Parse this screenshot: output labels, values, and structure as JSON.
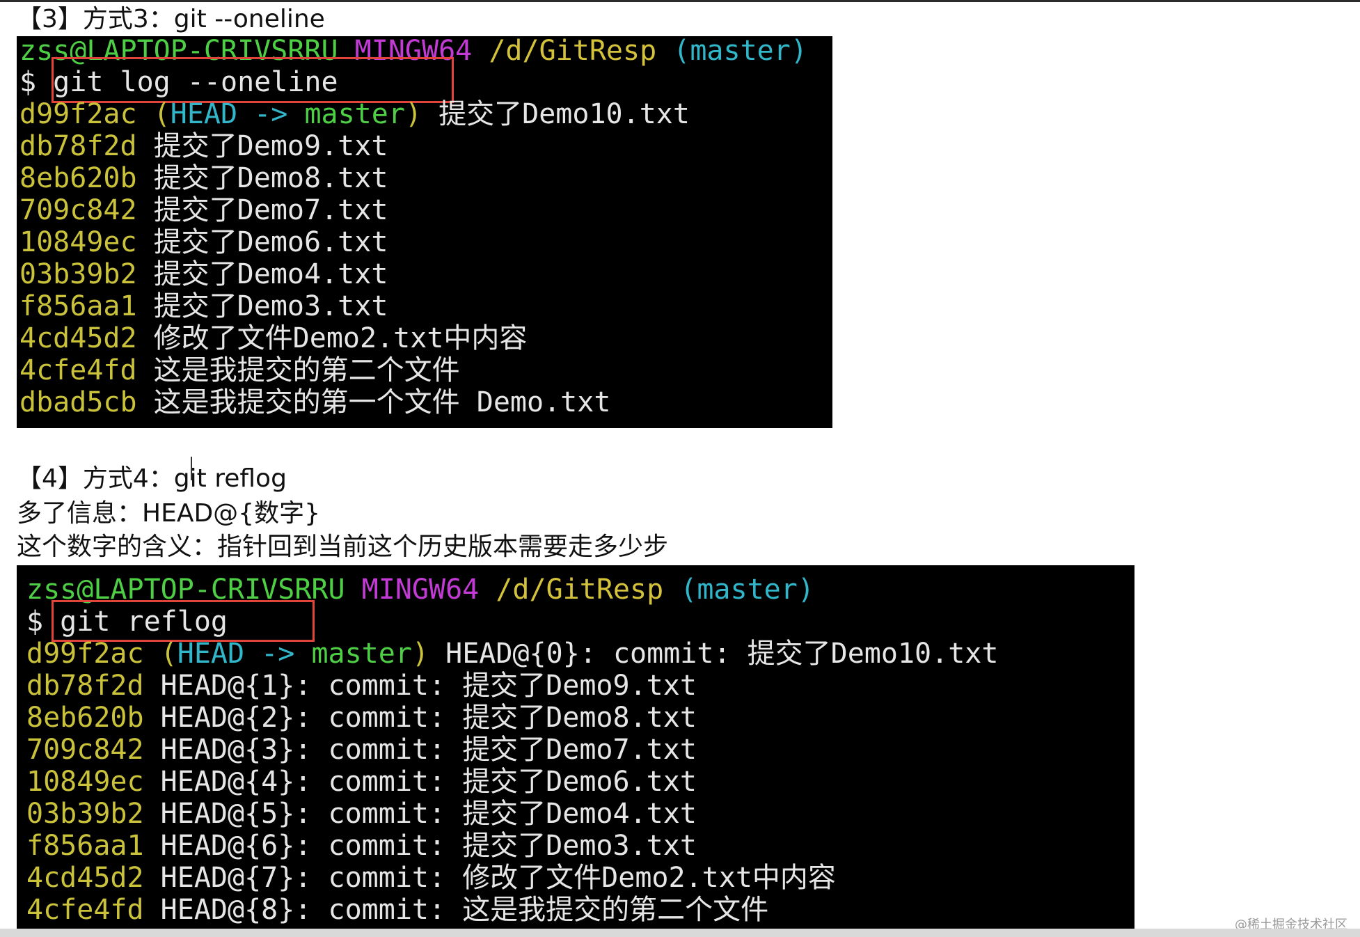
{
  "section3": {
    "heading": "【3】方式3：git --oneline",
    "terminal": {
      "prompt": {
        "user": "zss@LAPTOP-CRIVSRRU",
        "env": "MINGW64",
        "path": "/d/GitResp",
        "branch": "(master)"
      },
      "command": "$ git log --oneline",
      "head_ref": "(HEAD -> master)",
      "entries": [
        {
          "hash": "d99f2ac",
          "message": "提交了Demo10.txt"
        },
        {
          "hash": "db78f2d",
          "message": "提交了Demo9.txt"
        },
        {
          "hash": "8eb620b",
          "message": "提交了Demo8.txt"
        },
        {
          "hash": "709c842",
          "message": "提交了Demo7.txt"
        },
        {
          "hash": "10849ec",
          "message": "提交了Demo6.txt"
        },
        {
          "hash": "03b39b2",
          "message": "提交了Demo4.txt"
        },
        {
          "hash": "f856aa1",
          "message": "提交了Demo3.txt"
        },
        {
          "hash": "4cd45d2",
          "message": "修改了文件Demo2.txt中内容"
        },
        {
          "hash": "4cfe4fd",
          "message": "这是我提交的第二个文件"
        },
        {
          "hash": "dbad5cb",
          "message": "这是我提交的第一个文件 Demo.txt"
        }
      ]
    }
  },
  "section4": {
    "heading": "【4】方式4：git reflog",
    "note1": "多了信息：HEAD@{数字}",
    "note2": "这个数字的含义：指针回到当前这个历史版本需要走多少步",
    "terminal": {
      "prompt": {
        "user": "zss@LAPTOP-CRIVSRRU",
        "env": "MINGW64",
        "path": "/d/GitResp",
        "branch": "(master)"
      },
      "command": "$ git reflog",
      "head_ref": "(HEAD -> master)",
      "entries": [
        {
          "hash": "d99f2ac",
          "ref": "HEAD@{0}:",
          "action": "commit:",
          "message": "提交了Demo10.txt"
        },
        {
          "hash": "db78f2d",
          "ref": "HEAD@{1}:",
          "action": "commit:",
          "message": "提交了Demo9.txt"
        },
        {
          "hash": "8eb620b",
          "ref": "HEAD@{2}:",
          "action": "commit:",
          "message": "提交了Demo8.txt"
        },
        {
          "hash": "709c842",
          "ref": "HEAD@{3}:",
          "action": "commit:",
          "message": "提交了Demo7.txt"
        },
        {
          "hash": "10849ec",
          "ref": "HEAD@{4}:",
          "action": "commit:",
          "message": "提交了Demo6.txt"
        },
        {
          "hash": "03b39b2",
          "ref": "HEAD@{5}:",
          "action": "commit:",
          "message": "提交了Demo4.txt"
        },
        {
          "hash": "f856aa1",
          "ref": "HEAD@{6}:",
          "action": "commit:",
          "message": "提交了Demo3.txt"
        },
        {
          "hash": "4cd45d2",
          "ref": "HEAD@{7}:",
          "action": "commit:",
          "message": "修改了文件Demo2.txt中内容"
        },
        {
          "hash": "4cfe4fd",
          "ref": "HEAD@{8}:",
          "action": "commit:",
          "message": "这是我提交的第二个文件"
        }
      ]
    }
  },
  "watermark": "@稀土掘金技术社区",
  "colors": {
    "highlight_box": "#e0443a",
    "terminal_bg": "#000000",
    "hash": "#c9c23a",
    "head": "#32b6c9",
    "master": "#4ecf45"
  }
}
